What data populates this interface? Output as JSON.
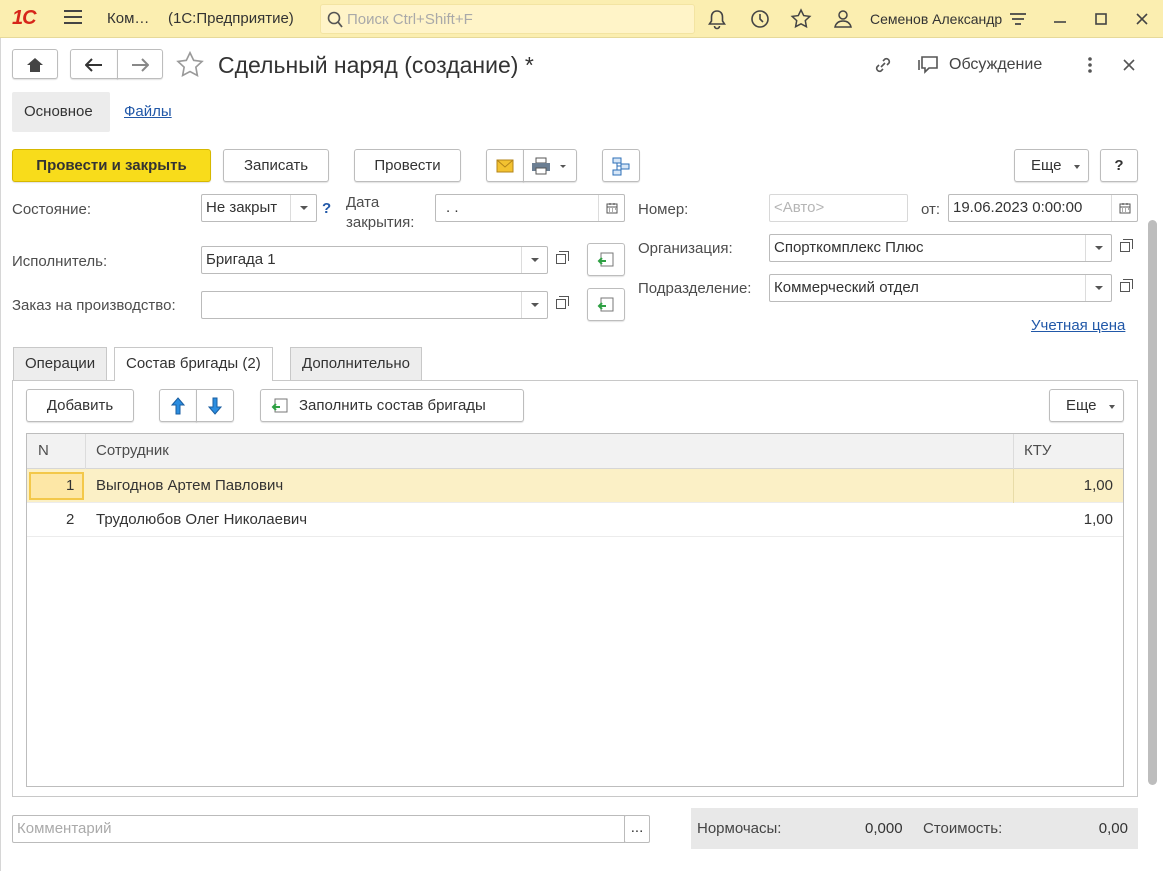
{
  "topbar": {
    "app_short": "Ком…",
    "app_name": "(1С:Предприятие)",
    "search_placeholder": "Поиск Ctrl+Shift+F",
    "user": "Семенов Александр"
  },
  "window": {
    "title": "Сдельный наряд (создание) *",
    "discussion": "Обсуждение"
  },
  "nav_tabs": [
    "Основное",
    "Файлы"
  ],
  "toolbar": {
    "post_close": "Провести и закрыть",
    "save": "Записать",
    "post": "Провести",
    "more": "Еще",
    "help": "?"
  },
  "form": {
    "state_label": "Состояние:",
    "state_value": "Не закрыт",
    "close_date_label_1": "Дата",
    "close_date_label_2": "закрытия:",
    "close_date_value": " .  .",
    "number_label": "Номер:",
    "number_placeholder": "<Авто>",
    "from_label": "от:",
    "from_value": "19.06.2023  0:00:00",
    "executor_label": "Исполнитель:",
    "executor_value": "Бригада 1",
    "org_label": "Организация:",
    "org_value": "Спорткомплекс Плюс",
    "order_label": "Заказ на производство:",
    "order_value": "",
    "dept_label": "Подразделение:",
    "dept_value": "Коммерческий отдел",
    "price_link": "Учетная цена"
  },
  "tabs": [
    "Операции",
    "Состав бригады (2)",
    "Дополнительно"
  ],
  "team": {
    "add": "Добавить",
    "fill": "Заполнить состав бригады",
    "more": "Еще",
    "columns": [
      "N",
      "Сотрудник",
      "КТУ"
    ],
    "rows": [
      {
        "n": "1",
        "name": "Выгоднов Артем Павлович",
        "ktu": "1,00"
      },
      {
        "n": "2",
        "name": "Трудолюбов Олег Николаевич",
        "ktu": "1,00"
      }
    ]
  },
  "footer": {
    "comment_placeholder": "Комментарий",
    "comment_btn": "...",
    "hours_label": "Нормочасы:",
    "hours_value": "0,000",
    "cost_label": "Стоимость:",
    "cost_value": "0,00"
  }
}
